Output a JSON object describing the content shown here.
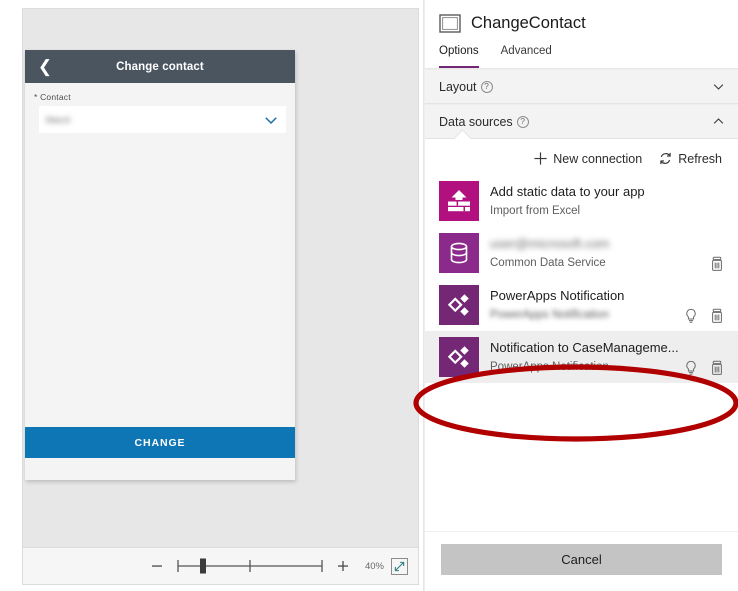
{
  "canvas": {
    "phone": {
      "back_icon": "chevron-left-icon",
      "title": "Change contact",
      "field_label": "Contact",
      "required_marker": "*",
      "dropdown_value": "Marcil",
      "dropdown_caret_icon": "chevron-down-icon",
      "submit_label": "CHANGE"
    },
    "zoom_bar": {
      "minus_label": "−",
      "plus_label": "+",
      "percent": "40%",
      "slider_value": 40,
      "slider_min": 0,
      "slider_max": 100,
      "fullscreen_icon": "expand-icon",
      "minus_icon": "minus-icon",
      "plus_icon": "plus-icon"
    }
  },
  "side_panel": {
    "screen_icon": "screen-icon",
    "title": "ChangeContact",
    "tabs": [
      {
        "label": "Options",
        "active": true
      },
      {
        "label": "Advanced",
        "active": false
      }
    ],
    "sections": [
      {
        "label": "Layout",
        "help_icon": "help-circle-icon",
        "expanded": false,
        "chevron_icon": "chevron-down-icon"
      },
      {
        "label": "Data sources",
        "help_icon": "help-circle-icon",
        "expanded": true,
        "chevron_icon": "chevron-up-icon"
      }
    ],
    "data_sources_actions": [
      {
        "label": "New connection",
        "icon": "plus-icon"
      },
      {
        "label": "Refresh",
        "icon": "refresh-icon"
      }
    ],
    "data_sources": [
      {
        "title": "Add static data to your app",
        "subtitle": "Import from Excel",
        "icon": "upload-data-icon",
        "icon_color": "#b2107f",
        "title_blurred": false,
        "subtitle_blurred": false,
        "selected": false,
        "actions": []
      },
      {
        "title": "user@microsoft.com",
        "subtitle": "Common Data Service",
        "icon": "database-icon",
        "icon_color": "#8c2a8c",
        "title_blurred": true,
        "subtitle_blurred": false,
        "selected": false,
        "actions": [
          "trash-icon"
        ]
      },
      {
        "title": "PowerApps Notification",
        "subtitle": "PowerApps Notification",
        "icon": "powerapps-icon",
        "icon_color": "#742774",
        "title_blurred": false,
        "subtitle_blurred": true,
        "selected": false,
        "actions": [
          "lightbulb-icon",
          "trash-icon"
        ]
      },
      {
        "title": "Notification to CaseManageme...",
        "subtitle": "PowerApps Notification",
        "icon": "powerapps-icon",
        "icon_color": "#742774",
        "title_blurred": false,
        "subtitle_blurred": false,
        "selected": true,
        "actions": [
          "lightbulb-icon",
          "trash-icon"
        ]
      }
    ],
    "cancel_label": "Cancel"
  },
  "annotation": {
    "shape": "ellipse",
    "color": "#b00000",
    "target": "Notification to CaseManageme..."
  },
  "colors": {
    "accent_purple": "#742774",
    "submit_blue": "#0f76b5",
    "phone_header": "#4a5560",
    "annotation_red": "#b00000"
  }
}
